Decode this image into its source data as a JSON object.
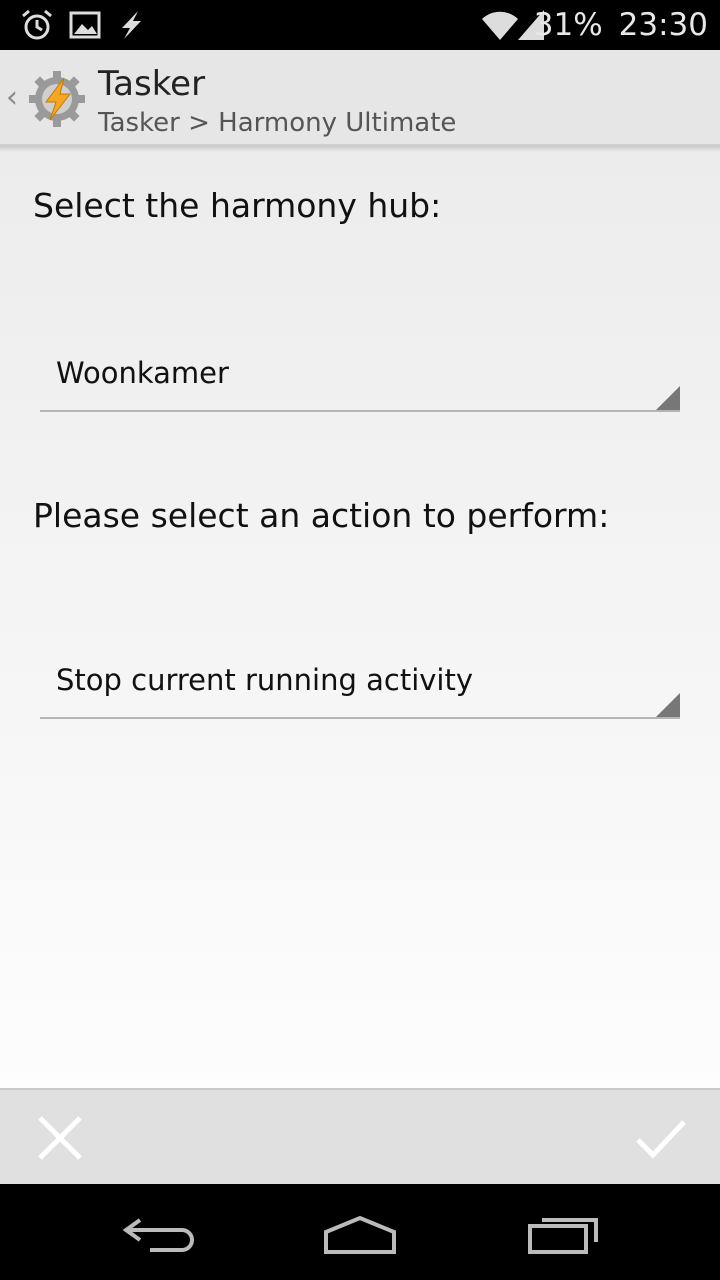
{
  "status_bar": {
    "battery": "31%",
    "time": "23:30",
    "icons": [
      "alarm-icon",
      "image-notification-icon",
      "lightning-icon",
      "wifi-icon",
      "signal-icon"
    ]
  },
  "action_bar": {
    "title": "Tasker",
    "subtitle": "Tasker > Harmony Ultimate",
    "up_glyph": "‹"
  },
  "form": {
    "hub_label": "Select the harmony hub:",
    "hub_value": "Woonkamer",
    "action_label": "Please select an action to perform:",
    "action_value": "Stop current running activity"
  },
  "buttons": {
    "cancel_icon": "close-icon",
    "confirm_icon": "checkmark-icon"
  },
  "navigation": {
    "icons": [
      "back-icon",
      "home-icon",
      "recents-icon"
    ]
  },
  "colors": {
    "action_bar_bg": "#e6e6e6",
    "icon_accent": "#f5a623"
  }
}
